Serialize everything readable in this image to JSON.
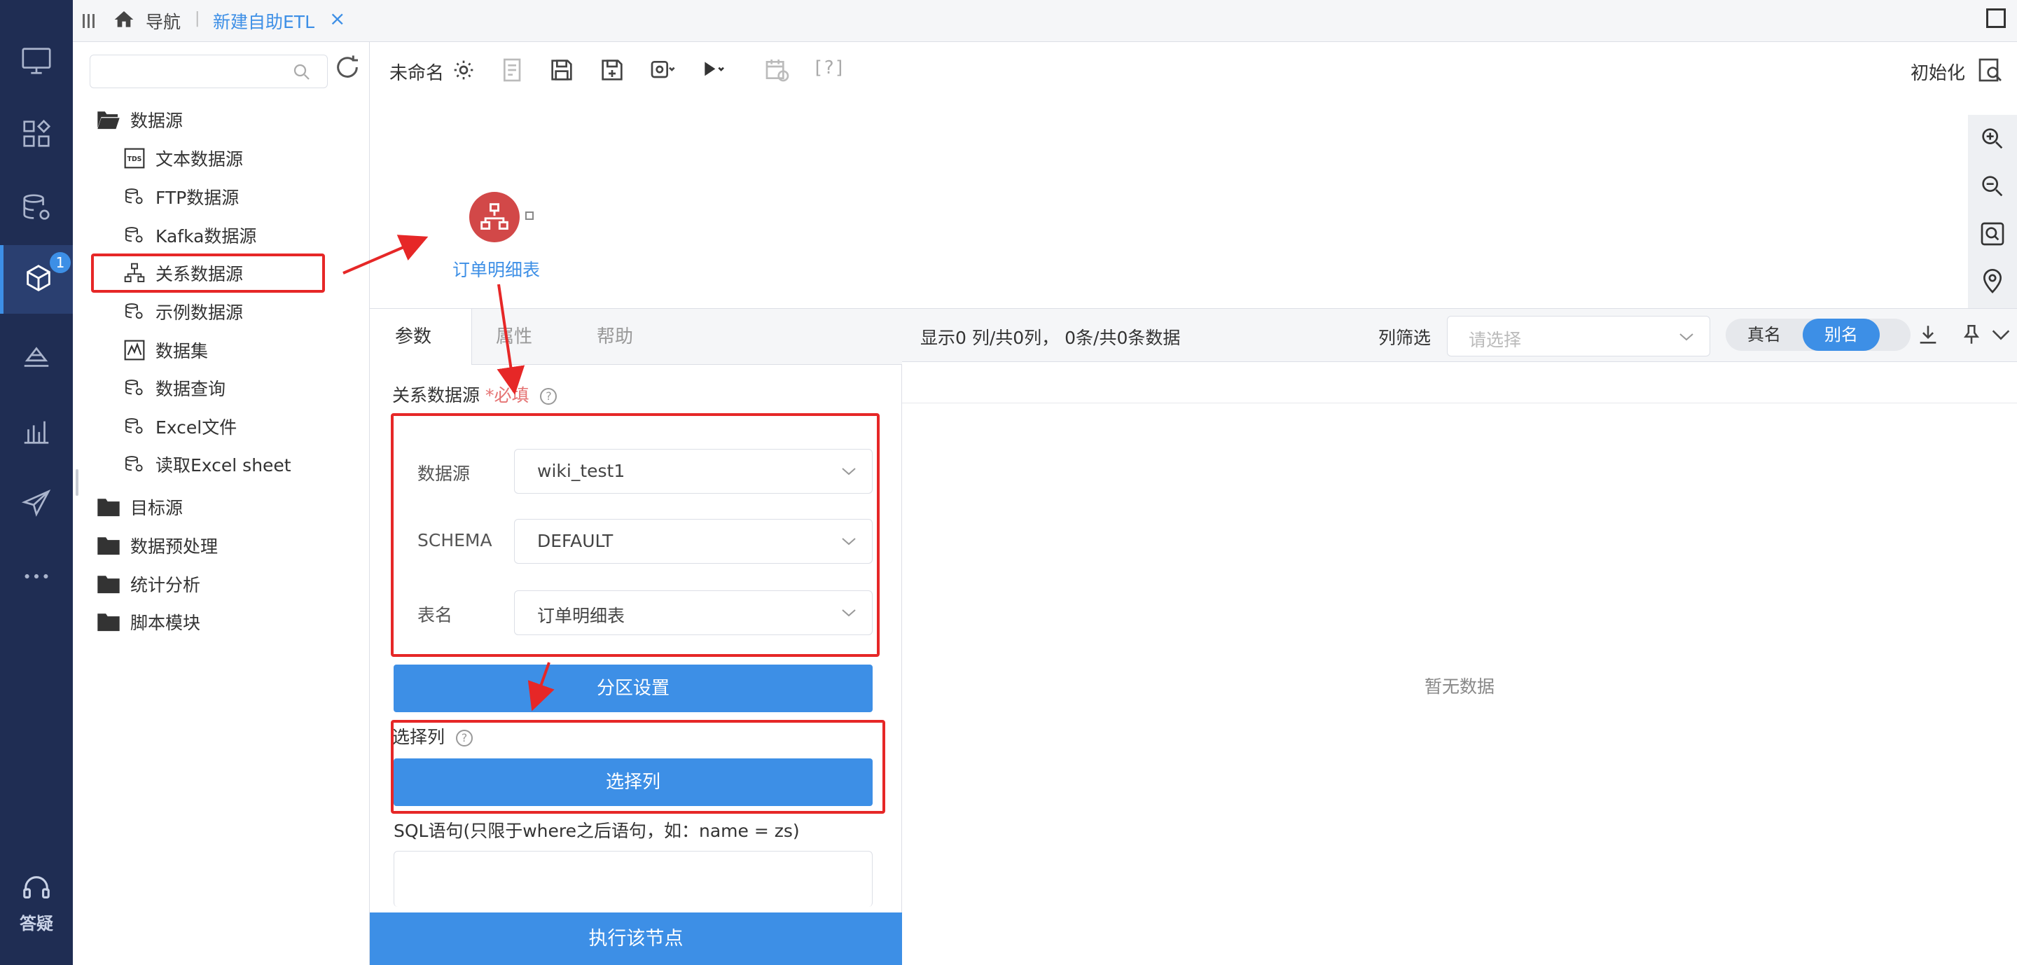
{
  "rail": {
    "badge": "1",
    "help_label": "答疑"
  },
  "topbar": {
    "nav_label": "导航",
    "separator": "|",
    "active_tab": "新建自助ETL",
    "close_glyph": "×"
  },
  "tree": {
    "search_placeholder": "",
    "folders": [
      {
        "label": "数据源",
        "icon": "folder-open-icon"
      },
      {
        "label": "目标源",
        "icon": "folder-icon"
      },
      {
        "label": "数据预处理",
        "icon": "folder-icon"
      },
      {
        "label": "统计分析",
        "icon": "folder-icon"
      },
      {
        "label": "脚本模块",
        "icon": "folder-icon"
      }
    ],
    "datasource_items": [
      {
        "label": "文本数据源",
        "icon": "tds-icon"
      },
      {
        "label": "FTP数据源",
        "icon": "database-icon"
      },
      {
        "label": "Kafka数据源",
        "icon": "database-icon"
      },
      {
        "label": "关系数据源",
        "icon": "hierarchy-icon"
      },
      {
        "label": "示例数据源",
        "icon": "database-icon"
      },
      {
        "label": "数据集",
        "icon": "dataset-icon"
      },
      {
        "label": "数据查询",
        "icon": "database-icon"
      },
      {
        "label": "Excel文件",
        "icon": "database-icon"
      },
      {
        "label": "读取Excel sheet",
        "icon": "database-icon"
      }
    ]
  },
  "toolbar": {
    "title": "未命名",
    "help_text": "[?]",
    "init_label": "初始化"
  },
  "canvas": {
    "node_label": "订单明细表"
  },
  "props": {
    "tabs": [
      "参数",
      "属性",
      "帮助"
    ],
    "section_title": "关系数据源",
    "required_text": "*必填",
    "help_glyph": "?",
    "rows": [
      {
        "label": "数据源",
        "value": "wiki_test1"
      },
      {
        "label": "SCHEMA",
        "value": "DEFAULT"
      },
      {
        "label": "表名",
        "value": "订单明细表"
      }
    ],
    "partition_button": "分区设置",
    "select_columns_title": "选择列",
    "select_columns_button": "选择列",
    "sql_label": "SQL语句(只限于where之后语句，如：name = zs)",
    "run_button": "执行该节点"
  },
  "preview": {
    "info": "显示0 列/共0列， 0条/共0条数据",
    "filter_label": "列筛选",
    "filter_placeholder": "请选择",
    "toggle_real": "真名",
    "toggle_alias": "别名",
    "empty_text": "暂无数据"
  },
  "colors": {
    "rail_bg": "#1f2d53",
    "accent": "#3d8fe6",
    "node": "#d24848",
    "annotation": "#e62727"
  }
}
